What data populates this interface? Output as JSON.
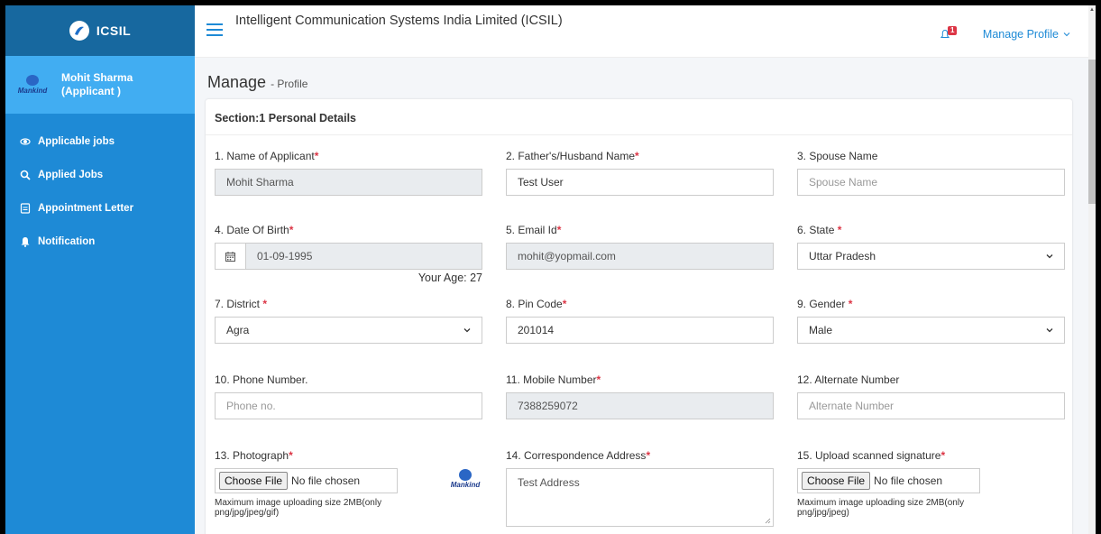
{
  "brand": {
    "name": "ICSIL"
  },
  "user": {
    "name": "Mohit Sharma",
    "role": "(Applicant )",
    "avatar_text": "Mankind"
  },
  "nav": [
    {
      "label": "Applicable jobs",
      "icon": "eye-icon"
    },
    {
      "label": "Applied Jobs",
      "icon": "search-icon"
    },
    {
      "label": "Appointment Letter",
      "icon": "document-icon"
    },
    {
      "label": "Notification",
      "icon": "bell-icon"
    }
  ],
  "header": {
    "title": "Intelligent Communication Systems India Limited (ICSIL)",
    "notification_count": "1",
    "manage_profile": "Manage Profile"
  },
  "page": {
    "title": "Manage",
    "subtitle": "- Profile"
  },
  "section": {
    "title": "Section:1 Personal Details"
  },
  "fields": {
    "name": {
      "label": "1. Name of Applicant",
      "value": "Mohit Sharma"
    },
    "father": {
      "label": "2. Father's/Husband Name",
      "value": "Test User"
    },
    "spouse": {
      "label": "3. Spouse Name",
      "placeholder": "Spouse Name"
    },
    "dob": {
      "label": "4. Date Of Birth",
      "value": "01-09-1995",
      "age": "Your Age: 27"
    },
    "email": {
      "label": "5. Email Id",
      "value": "mohit@yopmail.com"
    },
    "state": {
      "label": "6. State ",
      "value": "Uttar Pradesh"
    },
    "district": {
      "label": "7. District ",
      "value": "Agra"
    },
    "pin": {
      "label": "8. Pin Code",
      "value": "201014"
    },
    "gender": {
      "label": "9. Gender ",
      "value": "Male"
    },
    "phone": {
      "label": "10. Phone Number.",
      "placeholder": "Phone no."
    },
    "mobile": {
      "label": "11. Mobile Number",
      "value": "7388259072"
    },
    "alternate": {
      "label": "12. Alternate Number",
      "placeholder": "Alternate Number"
    },
    "photo": {
      "label": "13. Photograph",
      "button": "Choose File",
      "status": "No file chosen",
      "hint": "Maximum image uploading size 2MB(only png/jpg/jpeg/gif)",
      "preview_text": "Mankind"
    },
    "address": {
      "label": "14. Correspondence Address",
      "value": "Test Address"
    },
    "signature": {
      "label": "15. Upload scanned signature",
      "button": "Choose File",
      "status": "No file chosen",
      "hint": "Maximum image uploading size 2MB(only png/jpg/jpeg)"
    }
  },
  "colors": {
    "sidebar": "#1e8ad6",
    "brand_bar": "#17689f",
    "user_panel": "#41adf2",
    "required": "#dc3545"
  }
}
